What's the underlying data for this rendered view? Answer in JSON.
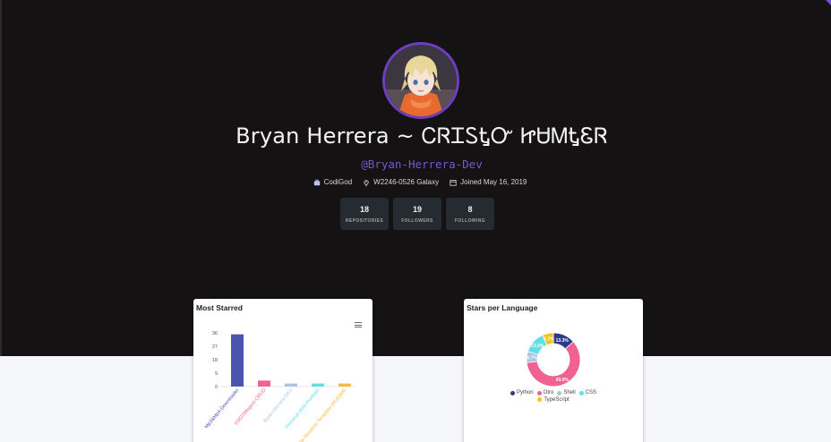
{
  "profile": {
    "name": "Bryan Herrera ~ ᏟᏒᏆᏚᎿᏅ ᏥᏌᎷᎿᏋᏒ",
    "handle": "@Bryan-Herrera-Dev",
    "avatar_icon": "anime-avatar",
    "accent_color": "#6d3fbf"
  },
  "meta": [
    {
      "icon": "briefcase-icon",
      "text": "CodiGod"
    },
    {
      "icon": "location-pin-icon",
      "text": "W2246-0526 Galaxy"
    },
    {
      "icon": "calendar-icon",
      "text": "Joined May 16, 2019"
    }
  ],
  "stats": [
    {
      "value": "18",
      "label": "REPOSITORIES"
    },
    {
      "value": "19",
      "label": "FOLLOWERS"
    },
    {
      "value": "8",
      "label": "FOLLOWING"
    }
  ],
  "chart_data": [
    {
      "type": "bar",
      "title": "Most Starred",
      "categories": [
        "Mp3&Mp4-Downloader",
        "EDOSMagico-CRUD",
        "Bryan-Herrera-DEV",
        "Personal-Web-Portfolio",
        "Profile-Readme-Template-README"
      ],
      "values": [
        35,
        4,
        2,
        2,
        2
      ],
      "ylim": [
        0,
        36
      ],
      "yticks": [
        0,
        9,
        18,
        27,
        36
      ],
      "colors": [
        "#4a55b0",
        "#f06292",
        "#a8c4e0",
        "#5de0e6",
        "#f6b93b"
      ]
    },
    {
      "type": "pie",
      "title": "Stars per Language",
      "categories": [
        "Python",
        "Otro",
        "Shell",
        "CSS",
        "TypeScript"
      ],
      "values": [
        13.3,
        60.0,
        6.7,
        13.3,
        6.7
      ],
      "labels": [
        "13.3%",
        "60.0%",
        "6.7%",
        "13.3%",
        "6.7%"
      ],
      "colors": [
        "#2e3a8c",
        "#f06292",
        "#a8c4e0",
        "#5de0e6",
        "#f6c21b"
      ]
    }
  ]
}
